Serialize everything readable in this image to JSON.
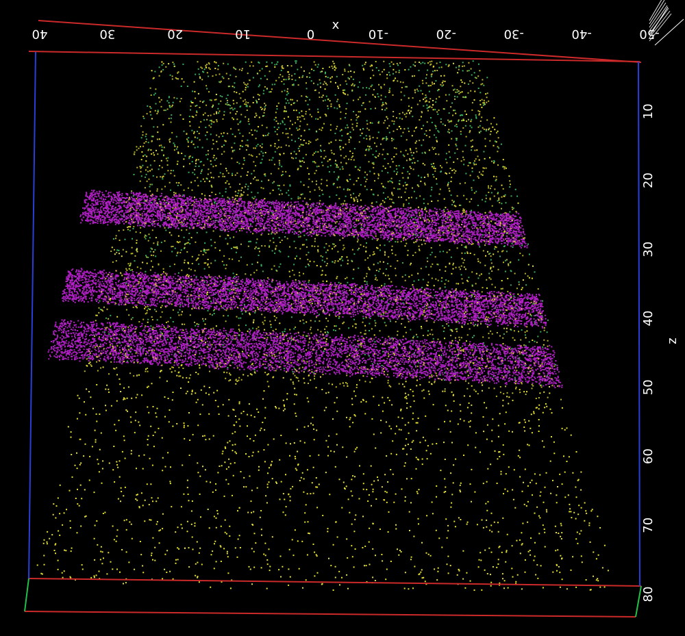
{
  "chart_data": {
    "type": "scatter",
    "view": "3D point cloud",
    "background_color": "#000000",
    "axes": {
      "x": {
        "title": "x",
        "range": [
          -50,
          40
        ],
        "reversed": true,
        "ticks": [
          "40",
          "30",
          "20",
          "10",
          "0",
          "-10",
          "-20",
          "-30",
          "-40",
          "-50"
        ],
        "color": "#cc2a2a"
      },
      "z": {
        "title": "z",
        "range": [
          0,
          80
        ],
        "ticks": [
          "10",
          "20",
          "30",
          "40",
          "50",
          "60",
          "70",
          "80"
        ],
        "color": "#2a3fd6"
      },
      "y": {
        "color": "#22c24a"
      }
    },
    "grid": false,
    "legend": "none",
    "series": [
      {
        "color": "#e8e233",
        "z_extent": [
          0,
          80
        ]
      },
      {
        "color": "#3fc46a",
        "z_extent": [
          0,
          48
        ]
      },
      {
        "color": "#b01fc4",
        "bands_z": [
          [
            23.5,
            28
          ],
          [
            35,
            39.5
          ],
          [
            42.5,
            48
          ]
        ]
      }
    ]
  }
}
